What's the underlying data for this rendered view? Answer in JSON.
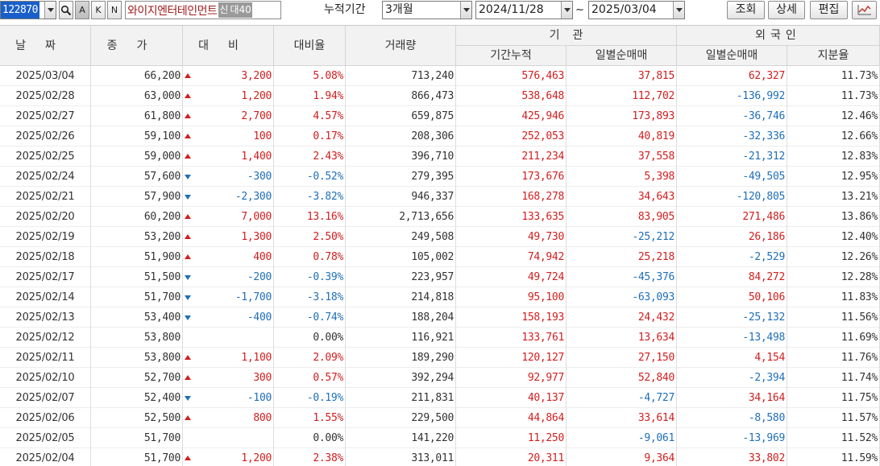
{
  "toolbar": {
    "stock_code": "122870",
    "buttons_small": [
      "A",
      "K",
      "N"
    ],
    "stock_name": "와이지엔터테인먼트",
    "badges": [
      "신",
      "대40"
    ],
    "period_label": "누적기간",
    "period_value": "3개월",
    "date_from": "2024/11/28",
    "tilde": "~",
    "date_to": "2025/03/04",
    "query_button": "조회",
    "detail_button": "상세",
    "edit_button": "편집",
    "chart_icon": "line-chart-icon",
    "colors": {
      "up": "#d21e1e",
      "down": "#1f6fb8",
      "code_highlight": "#1a5fc9",
      "name": "#a21c1c"
    }
  },
  "grid": {
    "headers": {
      "date": "날짜",
      "close": "종가",
      "change": "대비",
      "change_rate": "대비율",
      "volume": "거래량",
      "inst_group": "기관",
      "inst_cum": "기간누적",
      "inst_daily": "일별순매매",
      "foreign_group": "외국인",
      "foreign_daily": "일별순매매",
      "foreign_share": "지분율"
    },
    "rows": [
      {
        "date": "2025/03/04",
        "close": "66,200",
        "dir": "up",
        "change": "3,200",
        "rate": "5.08%",
        "volume": "713,240",
        "inst_cum": "576,463",
        "inst_daily": "37,815",
        "foreign_daily": "62,327",
        "share": "11.73%"
      },
      {
        "date": "2025/02/28",
        "close": "63,000",
        "dir": "up",
        "change": "1,200",
        "rate": "1.94%",
        "volume": "866,473",
        "inst_cum": "538,648",
        "inst_daily": "112,702",
        "foreign_daily": "-136,992",
        "share": "11.73%"
      },
      {
        "date": "2025/02/27",
        "close": "61,800",
        "dir": "up",
        "change": "2,700",
        "rate": "4.57%",
        "volume": "659,875",
        "inst_cum": "425,946",
        "inst_daily": "173,893",
        "foreign_daily": "-36,746",
        "share": "12.46%"
      },
      {
        "date": "2025/02/26",
        "close": "59,100",
        "dir": "up",
        "change": "100",
        "rate": "0.17%",
        "volume": "208,306",
        "inst_cum": "252,053",
        "inst_daily": "40,819",
        "foreign_daily": "-32,336",
        "share": "12.66%"
      },
      {
        "date": "2025/02/25",
        "close": "59,000",
        "dir": "up",
        "change": "1,400",
        "rate": "2.43%",
        "volume": "396,710",
        "inst_cum": "211,234",
        "inst_daily": "37,558",
        "foreign_daily": "-21,312",
        "share": "12.83%"
      },
      {
        "date": "2025/02/24",
        "close": "57,600",
        "dir": "down",
        "change": "-300",
        "rate": "-0.52%",
        "volume": "279,395",
        "inst_cum": "173,676",
        "inst_daily": "5,398",
        "foreign_daily": "-49,505",
        "share": "12.95%"
      },
      {
        "date": "2025/02/21",
        "close": "57,900",
        "dir": "down",
        "change": "-2,300",
        "rate": "-3.82%",
        "volume": "946,337",
        "inst_cum": "168,278",
        "inst_daily": "34,643",
        "foreign_daily": "-120,805",
        "share": "13.21%"
      },
      {
        "date": "2025/02/20",
        "close": "60,200",
        "dir": "up",
        "change": "7,000",
        "rate": "13.16%",
        "volume": "2,713,656",
        "inst_cum": "133,635",
        "inst_daily": "83,905",
        "foreign_daily": "271,486",
        "share": "13.86%"
      },
      {
        "date": "2025/02/19",
        "close": "53,200",
        "dir": "up",
        "change": "1,300",
        "rate": "2.50%",
        "volume": "249,508",
        "inst_cum": "49,730",
        "inst_daily": "-25,212",
        "foreign_daily": "26,186",
        "share": "12.40%"
      },
      {
        "date": "2025/02/18",
        "close": "51,900",
        "dir": "up",
        "change": "400",
        "rate": "0.78%",
        "volume": "105,002",
        "inst_cum": "74,942",
        "inst_daily": "25,218",
        "foreign_daily": "-2,529",
        "share": "12.26%"
      },
      {
        "date": "2025/02/17",
        "close": "51,500",
        "dir": "down",
        "change": "-200",
        "rate": "-0.39%",
        "volume": "223,957",
        "inst_cum": "49,724",
        "inst_daily": "-45,376",
        "foreign_daily": "84,272",
        "share": "12.28%"
      },
      {
        "date": "2025/02/14",
        "close": "51,700",
        "dir": "down",
        "change": "-1,700",
        "rate": "-3.18%",
        "volume": "214,818",
        "inst_cum": "95,100",
        "inst_daily": "-63,093",
        "foreign_daily": "50,106",
        "share": "11.83%"
      },
      {
        "date": "2025/02/13",
        "close": "53,400",
        "dir": "down",
        "change": "-400",
        "rate": "-0.74%",
        "volume": "188,204",
        "inst_cum": "158,193",
        "inst_daily": "24,432",
        "foreign_daily": "-25,132",
        "share": "11.56%"
      },
      {
        "date": "2025/02/12",
        "close": "53,800",
        "dir": "flat",
        "change": "",
        "rate": "0.00%",
        "volume": "116,921",
        "inst_cum": "133,761",
        "inst_daily": "13,634",
        "foreign_daily": "-13,498",
        "share": "11.69%"
      },
      {
        "date": "2025/02/11",
        "close": "53,800",
        "dir": "up",
        "change": "1,100",
        "rate": "2.09%",
        "volume": "189,290",
        "inst_cum": "120,127",
        "inst_daily": "27,150",
        "foreign_daily": "4,154",
        "share": "11.76%"
      },
      {
        "date": "2025/02/10",
        "close": "52,700",
        "dir": "up",
        "change": "300",
        "rate": "0.57%",
        "volume": "392,294",
        "inst_cum": "92,977",
        "inst_daily": "52,840",
        "foreign_daily": "-2,394",
        "share": "11.74%"
      },
      {
        "date": "2025/02/07",
        "close": "52,400",
        "dir": "down",
        "change": "-100",
        "rate": "-0.19%",
        "volume": "211,831",
        "inst_cum": "40,137",
        "inst_daily": "-4,727",
        "foreign_daily": "34,164",
        "share": "11.75%"
      },
      {
        "date": "2025/02/06",
        "close": "52,500",
        "dir": "up",
        "change": "800",
        "rate": "1.55%",
        "volume": "229,500",
        "inst_cum": "44,864",
        "inst_daily": "33,614",
        "foreign_daily": "-8,580",
        "share": "11.57%"
      },
      {
        "date": "2025/02/05",
        "close": "51,700",
        "dir": "flat",
        "change": "",
        "rate": "0.00%",
        "volume": "141,220",
        "inst_cum": "11,250",
        "inst_daily": "-9,061",
        "foreign_daily": "-13,969",
        "share": "11.52%"
      },
      {
        "date": "2025/02/04",
        "close": "51,700",
        "dir": "up",
        "change": "1,200",
        "rate": "2.38%",
        "volume": "313,011",
        "inst_cum": "20,311",
        "inst_daily": "9,364",
        "foreign_daily": "33,802",
        "share": "11.59%"
      }
    ]
  }
}
